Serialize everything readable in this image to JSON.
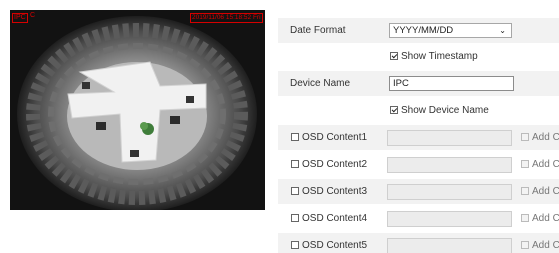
{
  "preview": {
    "osd_logo": "IPC",
    "osd_corner": "C",
    "osd_timestamp": "2019/11/06 15:18:52 Fri"
  },
  "settings": {
    "date_format_label": "Date Format",
    "date_format_value": "YYYY/MM/DD",
    "show_timestamp_label": "Show Timestamp",
    "show_timestamp_checked": true,
    "device_name_label": "Device Name",
    "device_name_value": "IPC",
    "show_device_name_label": "Show Device Name",
    "show_device_name_checked": true,
    "osd_contents": [
      {
        "label": "OSD Content1",
        "checked": false,
        "value": "",
        "add_label": "Add C"
      },
      {
        "label": "OSD Content2",
        "checked": false,
        "value": "",
        "add_label": "Add C"
      },
      {
        "label": "OSD Content3",
        "checked": false,
        "value": "",
        "add_label": "Add C"
      },
      {
        "label": "OSD Content4",
        "checked": false,
        "value": "",
        "add_label": "Add C"
      },
      {
        "label": "OSD Content5",
        "checked": false,
        "value": "",
        "add_label": "Add C"
      }
    ]
  },
  "icons": {
    "dropdown": "chevron-down-icon",
    "checkbox": "checkbox-icon"
  }
}
